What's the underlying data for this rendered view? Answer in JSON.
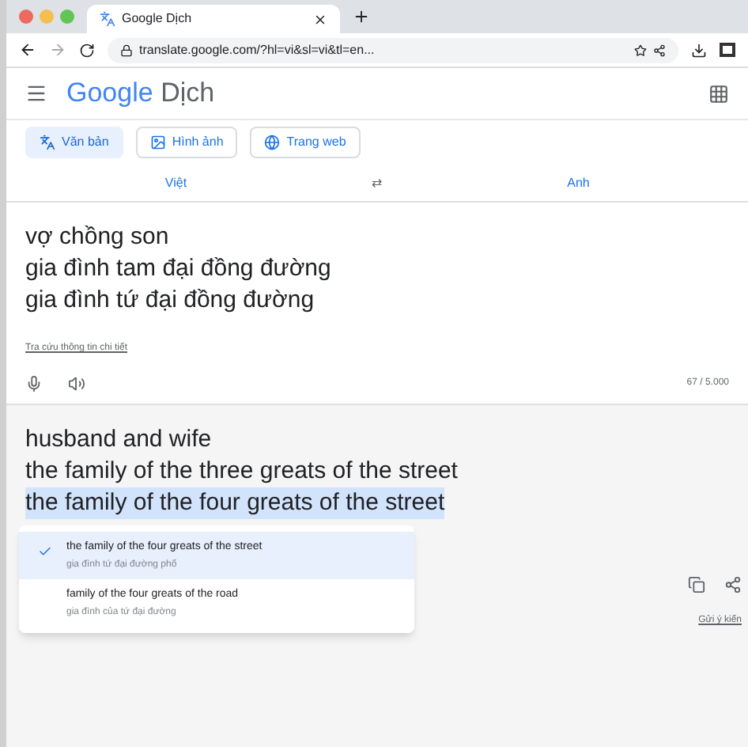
{
  "browser": {
    "tab_title": "Google Dịch",
    "address": "translate.google.com/?hl=vi&sl=vi&tl=en..."
  },
  "app": {
    "logo_google": "Google",
    "logo_suffix": "Dịch"
  },
  "modes": [
    {
      "label": "Văn bản",
      "selected": true
    },
    {
      "label": "Hình ảnh",
      "selected": false
    },
    {
      "label": "Trang web",
      "selected": false
    }
  ],
  "languages": {
    "source": "Việt",
    "swap": "⇄",
    "target": "Anh"
  },
  "source": {
    "lines": [
      "vợ chồng son",
      "gia đình tam đại đồng đường",
      "gia đình tứ đại đồng đường"
    ],
    "link": "Tra cứu thông tin chi tiết",
    "counter": "67 / 5.000"
  },
  "output": {
    "lines": [
      {
        "text": "husband and wife",
        "highlighted": false
      },
      {
        "text": "the family of the three greats of the street",
        "highlighted": false
      },
      {
        "text": "the family of the four greats of the street",
        "highlighted": true
      }
    ],
    "feedback": "Gửi ý kiến"
  },
  "alternatives": [
    {
      "text": "the family of the four greats of the street",
      "sub": "gia đình tứ đại đường phố",
      "selected": true
    },
    {
      "text": "family of the four greats of the road",
      "sub": "gia đình của tứ đại đường",
      "selected": false
    }
  ]
}
